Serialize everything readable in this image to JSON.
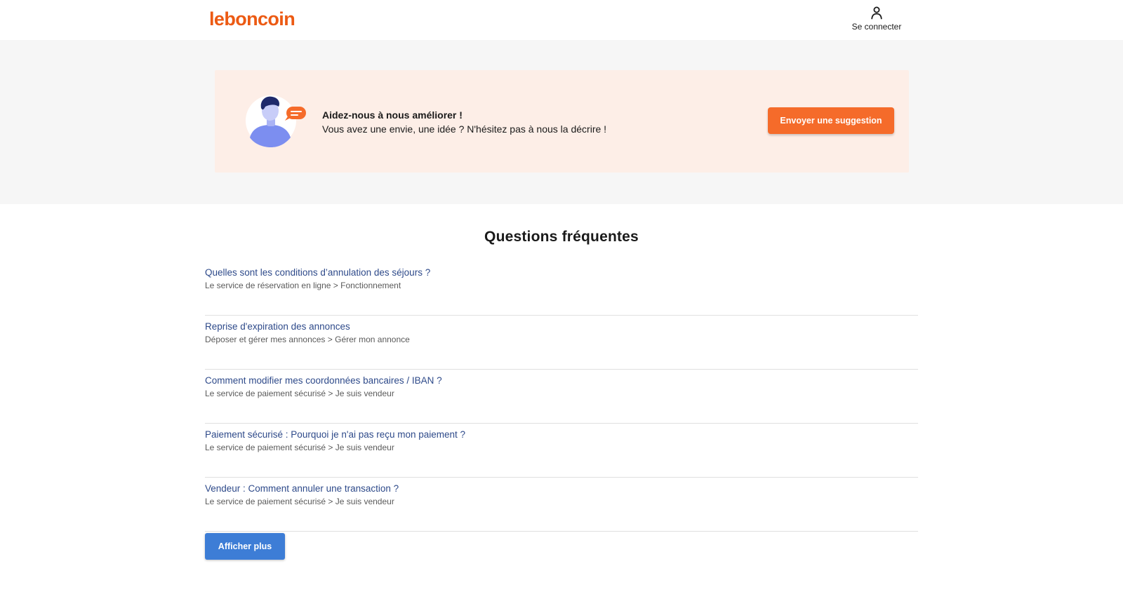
{
  "header": {
    "logo_text": "leboncoin",
    "login_label": "Se connecter",
    "login_icon": "user-icon"
  },
  "suggestion": {
    "title": "Aidez-nous à nous améliorer !",
    "subtitle": "Vous avez une envie, une idée ? N'hésitez pas à nous la décrire !",
    "button_label": "Envoyer une suggestion",
    "illustration": "person-speech-bubble-illustration"
  },
  "faq": {
    "title": "Questions fréquentes",
    "items": [
      {
        "question": "Quelles sont les conditions d’annulation des séjours ?",
        "path": "Le service de réservation en ligne > Fonctionnement"
      },
      {
        "question": "Reprise d'expiration des annonces",
        "path": "Déposer et gérer mes annonces > Gérer mon annonce"
      },
      {
        "question": "Comment modifier mes coordonnées bancaires / IBAN ?",
        "path": "Le service de paiement sécurisé > Je suis vendeur"
      },
      {
        "question": "Paiement sécurisé : Pourquoi je n'ai pas reçu mon paiement ?",
        "path": "Le service de paiement sécurisé > Je suis vendeur"
      },
      {
        "question": "Vendeur : Comment annuler une transaction ?",
        "path": "Le service de paiement sécurisé > Je suis vendeur"
      }
    ],
    "more_label": "Afficher plus"
  },
  "colors": {
    "brand_orange": "#ec5a13",
    "button_orange": "#f56b2a",
    "card_background": "#fdeee7",
    "link_blue": "#2e4a8a",
    "button_blue": "#3d7dd6"
  }
}
